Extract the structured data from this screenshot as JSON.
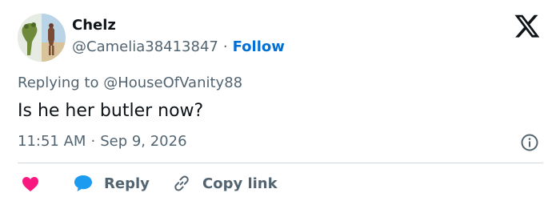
{
  "tweet": {
    "display_name": "Chelz",
    "handle": "@Camelia38413847",
    "separator": "·",
    "follow_label": "Follow",
    "replying_prefix": "Replying to",
    "replying_to": "@HouseOfVanity88",
    "text": "Is he her butler now?",
    "time": "11:51 AM",
    "date": "Sep 9, 2026"
  },
  "actions": {
    "reply_label": "Reply",
    "copy_link_label": "Copy link"
  },
  "icons": {
    "logo": "x-logo-icon",
    "info": "info-icon",
    "like": "heart-icon",
    "reply": "reply-bubble-icon",
    "copy": "link-icon"
  },
  "colors": {
    "text": "#0f1419",
    "secondary": "#536471",
    "link": "#006fd6",
    "heart": "#f91880",
    "reply_bubble": "#1d9bf0",
    "divider": "#cfd9de"
  }
}
